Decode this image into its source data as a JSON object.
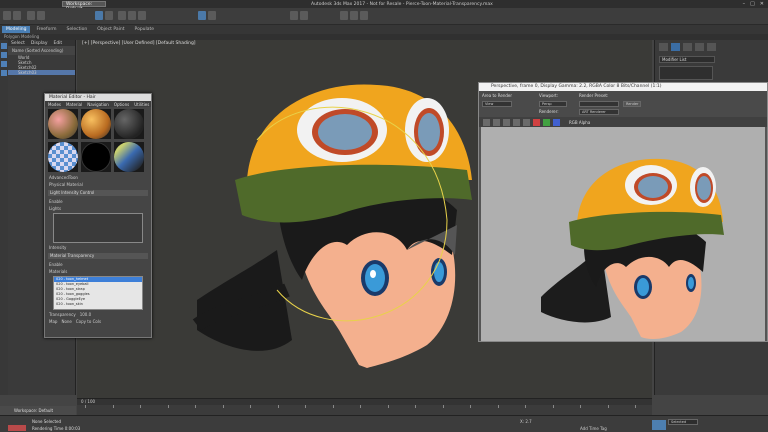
{
  "titlebar": {
    "workspace": "Workspace: Default",
    "app_title": "Autodesk 3ds Max 2017 - Not for Resale - Pierce-Toon-Material-Transparency.max"
  },
  "ribbon": {
    "tabs": [
      "Modeling",
      "Freeform",
      "Selection",
      "Object Paint",
      "Populate"
    ],
    "active": "Modeling",
    "sub": "Polygon Modeling"
  },
  "scene_explorer": {
    "menu": [
      "Select",
      "Display",
      "Edit"
    ],
    "header": "Name (Sorted Ascending)",
    "items": [
      {
        "label": "World",
        "selected": false
      },
      {
        "label": "Sketch",
        "selected": false
      },
      {
        "label": "Sketch02",
        "selected": false
      },
      {
        "label": "Sketch03",
        "selected": true
      }
    ]
  },
  "viewport": {
    "label": "[+] [Perspective] [User Defined] [Default Shading]"
  },
  "command_panel": {
    "modifier_list": "Modifier List"
  },
  "material_editor": {
    "title": "Material Editor - Hair",
    "menu": [
      "Modes",
      "Material",
      "Navigation",
      "Options",
      "Utilities"
    ],
    "material_name": "AdvancedToon",
    "material_type": "Physical Material",
    "light_section": "Light Intensity Control",
    "enable_1": "Enable",
    "lights_label": "Lights",
    "intensity_label": "Intensity",
    "transparency_section": "Material Transparency",
    "enable_2": "Enable",
    "materials_label": "Materials",
    "materials_list": [
      {
        "label": "020 - toon_helmet",
        "selected": true
      },
      {
        "label": "020 - toon_eyeball",
        "selected": false
      },
      {
        "label": "020 - toon_strap",
        "selected": false
      },
      {
        "label": "020 - toon_goggles",
        "selected": false
      },
      {
        "label": "020 - GoggleEye",
        "selected": false
      },
      {
        "label": "020 - toon_skin",
        "selected": false
      }
    ],
    "transparency_label": "Transparency",
    "transparency_value": "100.0",
    "map_label": "Map",
    "map_value": "None",
    "map_button": "Copy to Cols"
  },
  "render_window": {
    "title": "Perspective, frame 0, Display Gamma: 2.2, RGBA Color 8 Bits/Channel (1:1)",
    "area_label": "Area to Render",
    "area_value": "View",
    "viewport_label": "Viewport:",
    "viewport_value": "Persp",
    "preset_label": "Render Preset:",
    "preset_value": "",
    "renderer_label": "Renderer:",
    "renderer_value": "ART Renderer",
    "render_button": "Render",
    "channel": "RGB Alpha"
  },
  "status": {
    "workspace": "Workspace: Default",
    "selected": "None Selected",
    "render_time": "Rendering Time 0:00:03",
    "frame": "0 / 100",
    "set_key": "Selected",
    "add_time_tag": "Add Time Tag",
    "coord": "X: 2.7"
  },
  "colors": {
    "accent": "#4a7fb5",
    "helmet": "#f0a51e",
    "band": "#4f6a2a",
    "skin": "#f4b08e",
    "eyes": "#3a9ad8",
    "hair": "#1a1a1a"
  }
}
